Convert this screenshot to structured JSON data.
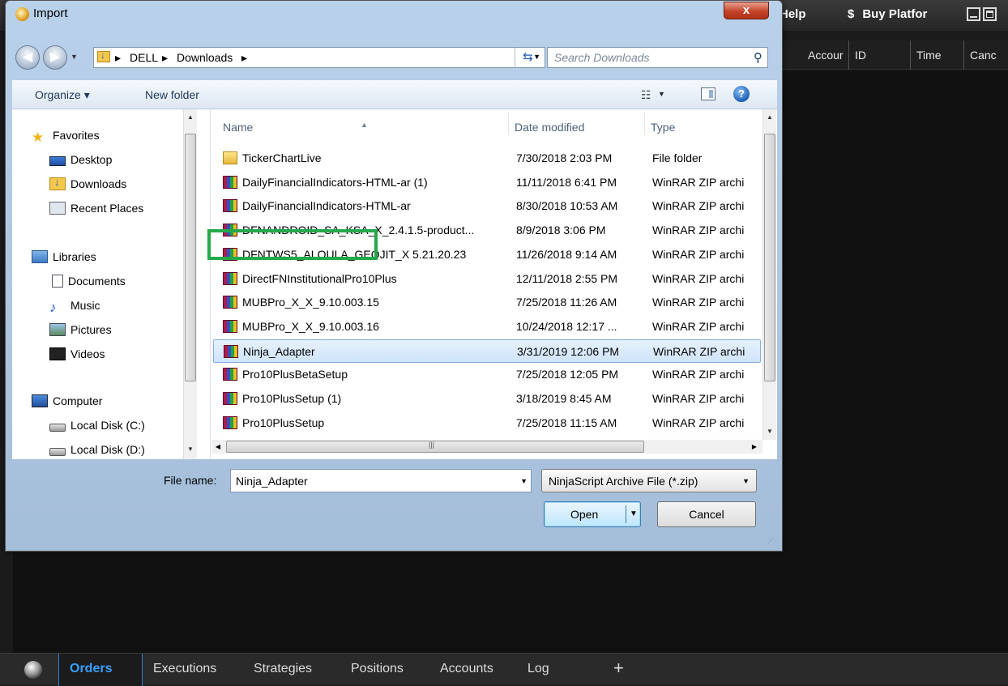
{
  "app": {
    "menu_help": "Help",
    "menu_buy": "Buy Platfor",
    "menu_buy_symbol": "$",
    "grid_headers": [
      "Accour",
      "ID",
      "Time",
      "Canc"
    ],
    "tabs": [
      "Orders",
      "Executions",
      "Strategies",
      "Positions",
      "Accounts",
      "Log"
    ],
    "add_tab": "+",
    "active_tab_color": "#3aa0ff"
  },
  "dialog": {
    "title": "Import",
    "close_label": "x",
    "breadcrumb": [
      "DELL",
      "Downloads"
    ],
    "search_placeholder": "Search Downloads",
    "toolbar": {
      "organize": "Organize ▾",
      "new_folder": "New folder"
    },
    "nav_pane": {
      "favorites": "Favorites",
      "desktop": "Desktop",
      "downloads": "Downloads",
      "recent_places": "Recent Places",
      "libraries": "Libraries",
      "documents": "Documents",
      "music": "Music",
      "pictures": "Pictures",
      "videos": "Videos",
      "computer": "Computer",
      "local_c": "Local Disk (C:)",
      "local_d": "Local Disk (D:)"
    },
    "columns": {
      "name": "Name",
      "date_modified": "Date modified",
      "type": "Type"
    },
    "files": [
      {
        "name": "TickerChartLive",
        "date": "7/30/2018 2:03 PM",
        "type": "File folder",
        "icon": "folder-icon"
      },
      {
        "name": "DailyFinancialIndicators-HTML-ar (1)",
        "date": "11/11/2018 6:41 PM",
        "type": "WinRAR ZIP archi",
        "icon": "winrar-icon"
      },
      {
        "name": "DailyFinancialIndicators-HTML-ar",
        "date": "8/30/2018 10:53 AM",
        "type": "WinRAR ZIP archi",
        "icon": "winrar-icon"
      },
      {
        "name": "DFNANDROID_SA_KSA_X_2.4.1.5-product...",
        "date": "8/9/2018 3:06 PM",
        "type": "WinRAR ZIP archi",
        "icon": "winrar-icon"
      },
      {
        "name": "DFNTWS5_ALOULA_GEOJIT_X 5.21.20.23",
        "date": "11/26/2018 9:14 AM",
        "type": "WinRAR ZIP archi",
        "icon": "winrar-icon"
      },
      {
        "name": "DirectFNInstitutionalPro10Plus",
        "date": "12/11/2018 2:55 PM",
        "type": "WinRAR ZIP archi",
        "icon": "winrar-icon"
      },
      {
        "name": "MUBPro_X_X_9.10.003.15",
        "date": "7/25/2018 11:26 AM",
        "type": "WinRAR ZIP archi",
        "icon": "winrar-icon"
      },
      {
        "name": "MUBPro_X_X_9.10.003.16",
        "date": "10/24/2018 12:17 ...",
        "type": "WinRAR ZIP archi",
        "icon": "winrar-icon"
      },
      {
        "name": "Ninja_Adapter",
        "date": "3/31/2019 12:06 PM",
        "type": "WinRAR ZIP archi",
        "icon": "winrar-icon"
      },
      {
        "name": "Pro10PlusBetaSetup",
        "date": "7/25/2018 12:05 PM",
        "type": "WinRAR ZIP archi",
        "icon": "winrar-icon"
      },
      {
        "name": "Pro10PlusSetup (1)",
        "date": "3/18/2019 8:45 AM",
        "type": "WinRAR ZIP archi",
        "icon": "winrar-icon"
      },
      {
        "name": "Pro10PlusSetup",
        "date": "7/25/2018 11:15 AM",
        "type": "WinRAR ZIP archi",
        "icon": "winrar-icon"
      }
    ],
    "selected_file": "Ninja_Adapter",
    "file_name_label": "File name:",
    "file_name_value": "Ninja_Adapter",
    "file_type_filter": "NinjaScript Archive File (*.zip)",
    "open_label": "Open",
    "cancel_label": "Cancel",
    "highlight_color": "#23a84a"
  }
}
